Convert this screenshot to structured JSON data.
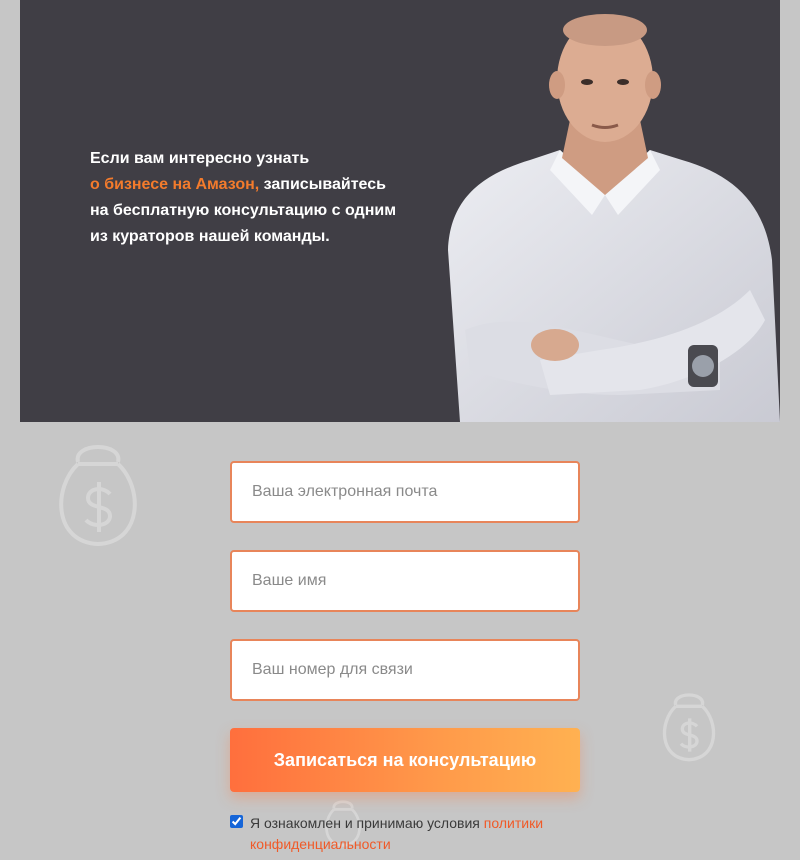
{
  "hero": {
    "line1": "Если вам интересно узнать",
    "accent": "о бизнесе на Амазон,",
    "line2_rest": " записывайтесь",
    "line3": "на бесплатную консультацию с одним",
    "line4": "из кураторов нашей команды."
  },
  "form": {
    "email_placeholder": "Ваша электронная почта",
    "name_placeholder": "Ваше имя",
    "phone_placeholder": "Ваш номер для связи",
    "submit_label": "Записаться на консультацию",
    "consent_text": "Я ознакомлен и принимаю условия ",
    "consent_link_1": "политики",
    "consent_link_2": "конфиденциальности",
    "consent_checked": true
  },
  "icons": {
    "background": "money-bag-icon"
  },
  "colors": {
    "hero_bg": "#403e45",
    "accent": "#f37b2c",
    "page_bg": "#c6c6c6",
    "field_border": "#e8855a",
    "button_start": "#ff6f3d",
    "button_end": "#ffb151",
    "link": "#f05a28"
  }
}
